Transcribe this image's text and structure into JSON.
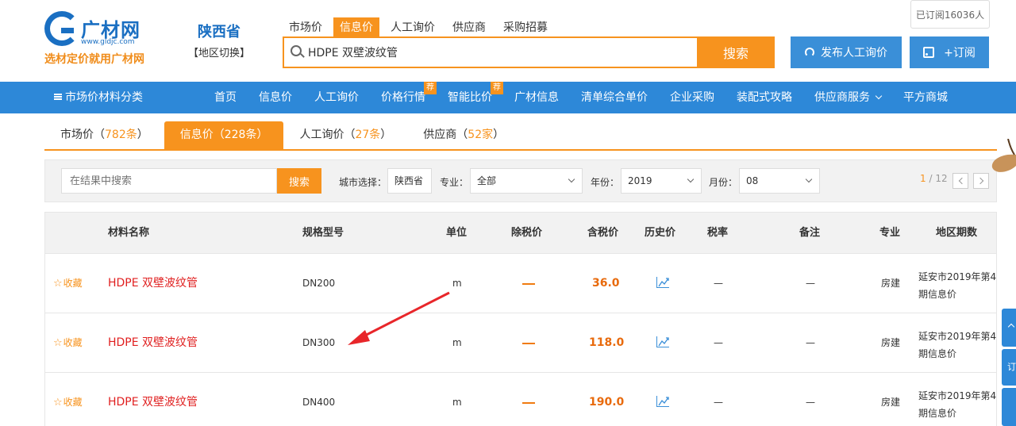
{
  "header": {
    "logo_name": "广材网",
    "logo_url": "www.gldjc.com",
    "slogan": "选材定价就用广材网",
    "region_name": "陕西省",
    "region_switch": "【地区切换】",
    "search_tabs": [
      "市场价",
      "信息价",
      "人工询价",
      "供应商",
      "采购招募"
    ],
    "search_active": "信息价",
    "search_value": "HDPE 双壁波纹管",
    "search_button": "搜索",
    "subscribed": "已订阅16036人",
    "publish_button": "发布人工询价",
    "subscribe_button": "+订阅"
  },
  "nav": {
    "category": "市场价材料分类",
    "items": [
      "首页",
      "信息价",
      "人工询价",
      "价格行情",
      "智能比价",
      "广材信息",
      "清单综合单价",
      "企业采购",
      "装配式攻略",
      "供应商服务",
      "平方商城"
    ],
    "badge": "荐"
  },
  "result_tabs": [
    {
      "label": "市场价（",
      "count": "782条",
      "close": "）"
    },
    {
      "label": "信息价（",
      "count": "228条",
      "close": "）"
    },
    {
      "label": "人工询价（",
      "count": "27条",
      "close": "）"
    },
    {
      "label": "供应商（",
      "count": "52家",
      "close": "）"
    }
  ],
  "filter": {
    "placeholder": "在结果中搜索",
    "search_button": "搜索",
    "city_label": "城市选择：",
    "city_value": "陕西省",
    "major_label": "专业：",
    "major_value": "全部",
    "year_label": "年份：",
    "year_value": "2019",
    "month_label": "月份：",
    "month_value": "08",
    "page_current": "1",
    "page_total": " / 12"
  },
  "table": {
    "headers": [
      "材料名称",
      "规格型号",
      "单位",
      "除税价",
      "含税价",
      "历史价",
      "税率",
      "备注",
      "专业",
      "地区期数"
    ],
    "fav_label": "收藏",
    "rows": [
      {
        "name": "HDPE 双壁波纹管",
        "spec": "DN200",
        "unit": "m",
        "tax_price": "36.0",
        "rate": "—",
        "remark": "—",
        "major": "房建",
        "period": "延安市2019年第4期信息价"
      },
      {
        "name": "HDPE 双壁波纹管",
        "spec": "DN300",
        "unit": "m",
        "tax_price": "118.0",
        "rate": "—",
        "remark": "—",
        "major": "房建",
        "period": "延安市2019年第4期信息价"
      },
      {
        "name": "HDPE 双壁波纹管",
        "spec": "DN400",
        "unit": "m",
        "tax_price": "190.0",
        "rate": "—",
        "remark": "—",
        "major": "房建",
        "period": "延安市2019年第4期信息价"
      }
    ]
  },
  "side": {
    "w2_text": "订"
  },
  "colors": {
    "orange": "#f7931e",
    "blue": "#2d88d8",
    "red": "#e02020"
  }
}
